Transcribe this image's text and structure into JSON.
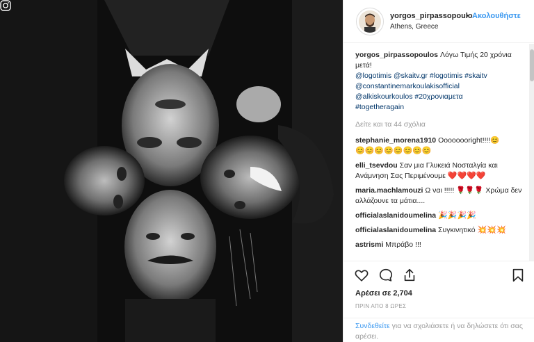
{
  "post": {
    "username": "yorgos_pirpassopoulo",
    "separator": "•",
    "follow_label": "Ακολουθήστε",
    "location": "Athens, Greece"
  },
  "caption": {
    "username": "yorgos_pirpassopoulos",
    "text": "Λόγω Τιμής 20 χρόνια μετά!",
    "tags": [
      "@logotimis",
      "@skaitv.gr",
      "#logotimis",
      "#skaitv",
      "@constantinemarkoulakisofficial",
      "@alkiskourkoulos",
      "#20χρονιαμετα",
      "#togetheragain"
    ]
  },
  "load_more": "Δείτε και τα 44 σχόλια",
  "comments": [
    {
      "user": "stephanie_morena1910",
      "text": "Oooooooright!!!!😊",
      "emoji": "😊😊😊😊😊😊😊😊"
    },
    {
      "user": "elli_tsevdou",
      "text": "Σαν μια Γλυκειά Νοσταλγία και Ανάμνηση Σας Περιμένουμε",
      "emoji": "❤️❤️❤️❤️"
    },
    {
      "user": "maria.machlamouzi",
      "text": "Ω ναι !!!!! 🌹🌹🌹 Χρώμα δεν αλλάζουνε τα μάτια....",
      "emoji": ""
    },
    {
      "user": "officialaslanidoumelina",
      "text": "",
      "emoji": "🎉🎉🎉🎉"
    },
    {
      "user": "officialaslanidoumelina",
      "text": "Συγκινητικό",
      "emoji": "💥💥💥"
    },
    {
      "user": "astrismi",
      "text": "Μπράβο !!!",
      "emoji": ""
    }
  ],
  "actions": {
    "likes_text": "Αρέσει σε 2,704",
    "time_ago": "ΠΡΙΝ ΑΠΟ 8 ΩΡΕΣ"
  },
  "login": {
    "link": "Συνδεθείτε",
    "text": "για να σχολιάσετε ή να δηλώσετε ότι σας αρέσει."
  },
  "icons": {
    "like": "heart-icon",
    "comment": "comment-icon",
    "share": "share-icon",
    "save": "bookmark-icon",
    "corner": "instagram-icon"
  },
  "colors": {
    "link": "#3897f0",
    "tag": "#003569",
    "muted": "#999999"
  }
}
